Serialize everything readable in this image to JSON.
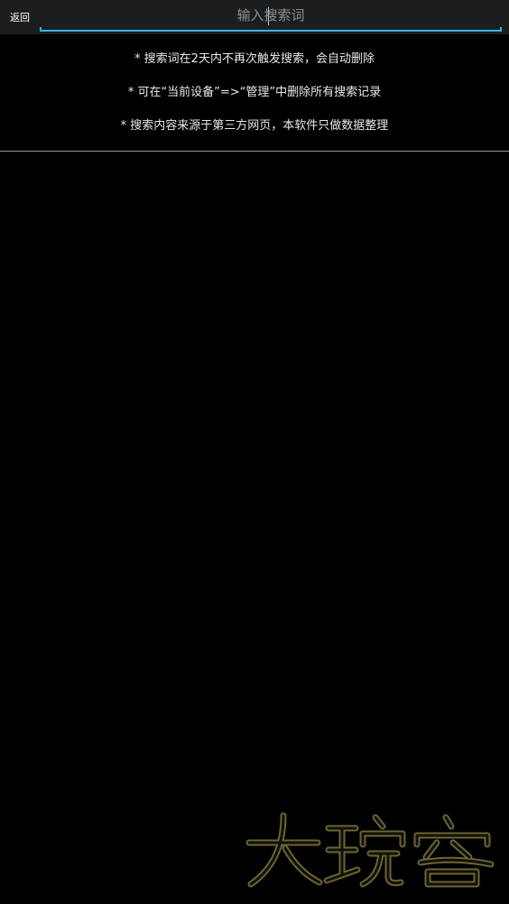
{
  "header": {
    "back_label": "返回",
    "search": {
      "value": "",
      "placeholder": "输入搜索词"
    }
  },
  "tips": [
    "* 搜索词在2天内不再次触发搜索，会自动删除",
    "* 可在“当前设备”=>“管理”中删除所有搜索记录",
    "* 搜索内容来源于第三方网页，本软件只做数据整理"
  ],
  "watermark": {
    "text": "大玩客"
  },
  "colors": {
    "background": "#000000",
    "topbar": "#1c1d1f",
    "accent": "#33b5e5",
    "text": "#e8e8e8",
    "placeholder": "#8d8f92",
    "divider": "#9a9a9a",
    "watermark_stroke": "#6b6434"
  }
}
